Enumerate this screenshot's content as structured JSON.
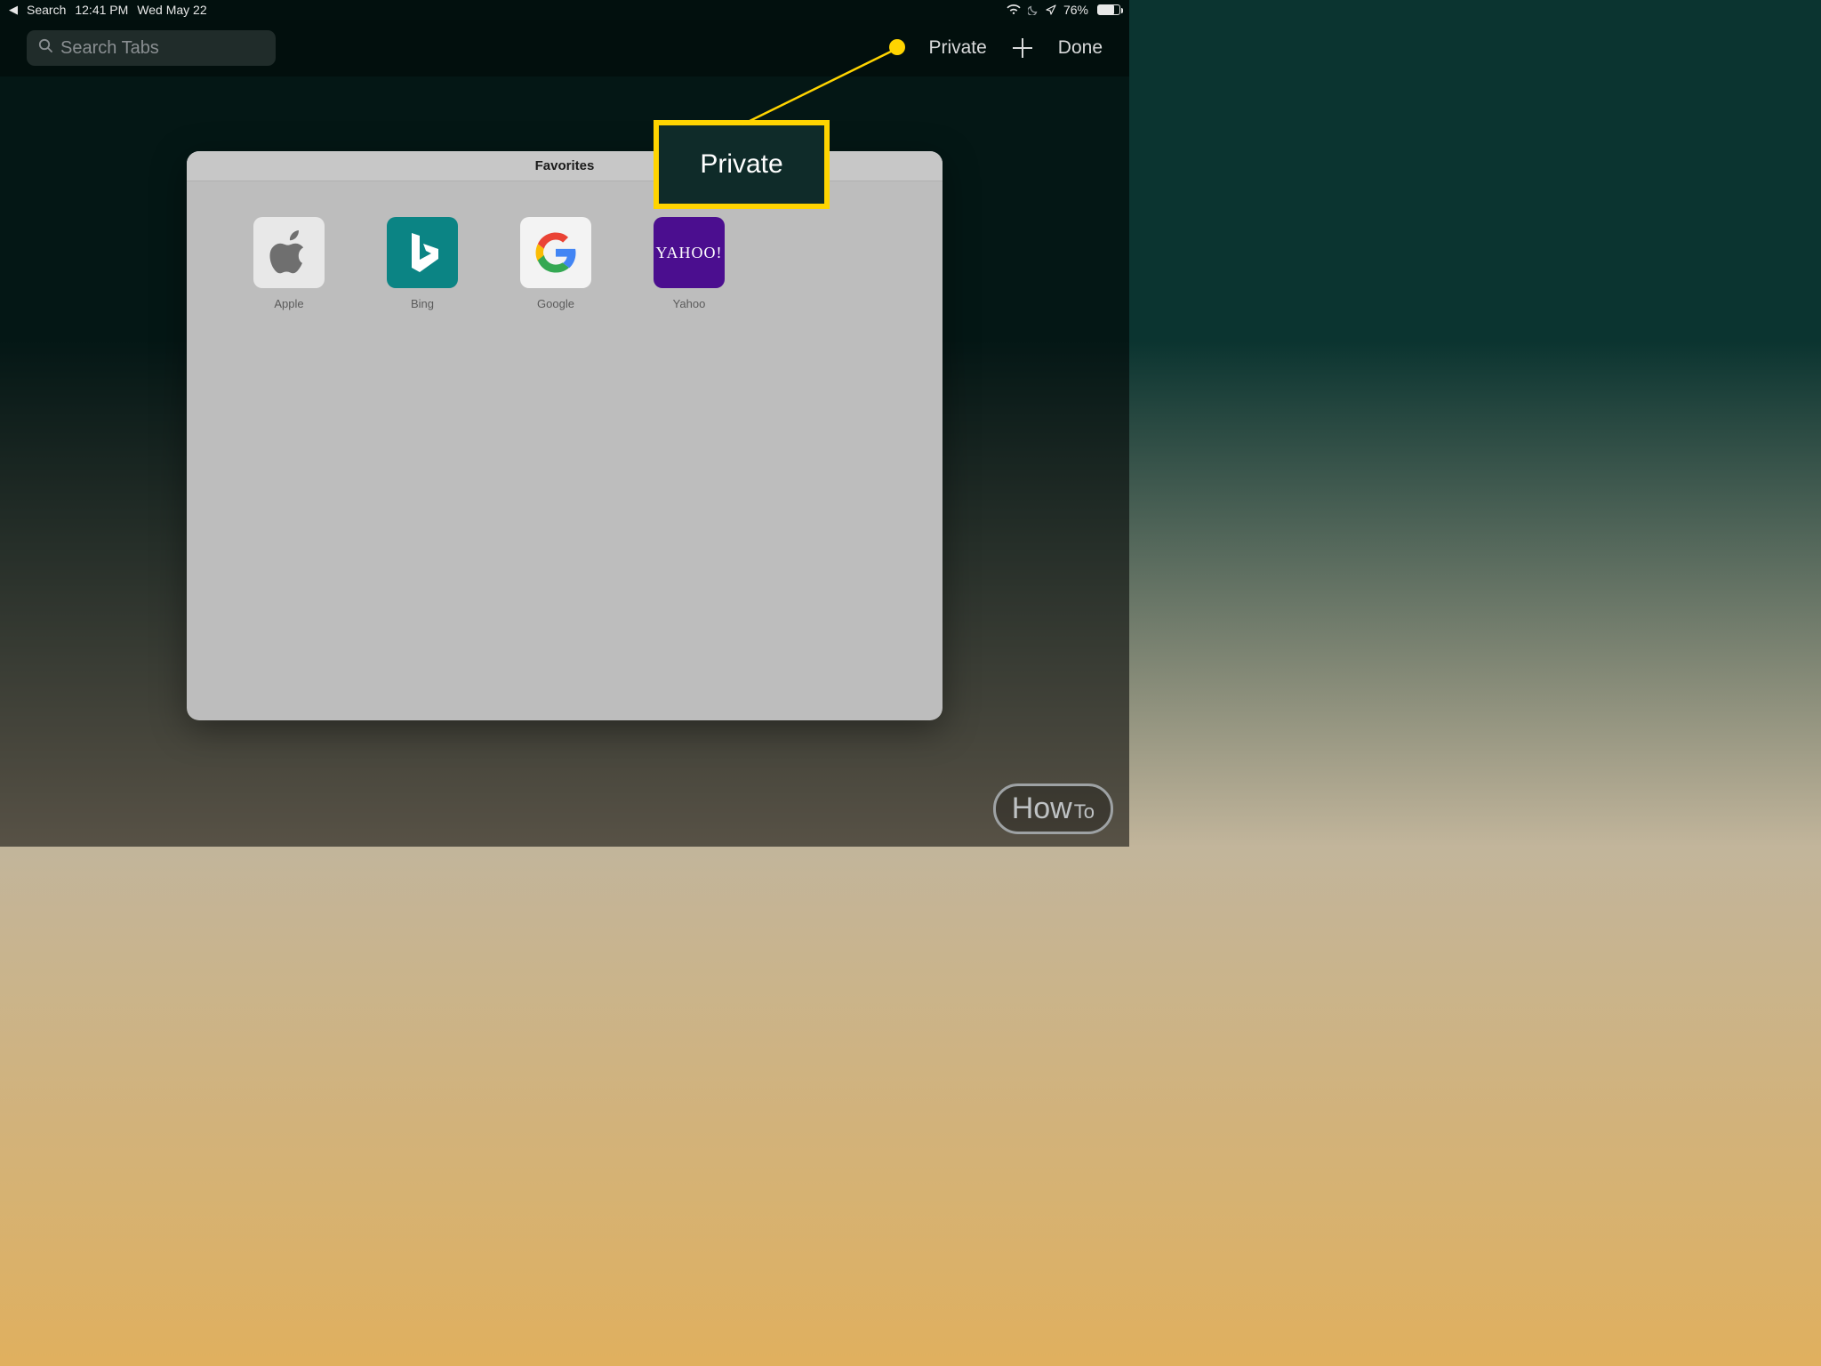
{
  "statusbar": {
    "back_label": "Search",
    "time": "12:41 PM",
    "date": "Wed May 22",
    "battery_percent": "76%"
  },
  "toolbar": {
    "search_placeholder": "Search Tabs",
    "private_label": "Private",
    "done_label": "Done"
  },
  "card": {
    "header": "Favorites",
    "favorites": [
      {
        "label": "Apple"
      },
      {
        "label": "Bing"
      },
      {
        "label": "Google"
      },
      {
        "label": "Yahoo"
      }
    ]
  },
  "annotation": {
    "callout_text": "Private"
  },
  "watermark": {
    "how": "How",
    "to": "To"
  }
}
